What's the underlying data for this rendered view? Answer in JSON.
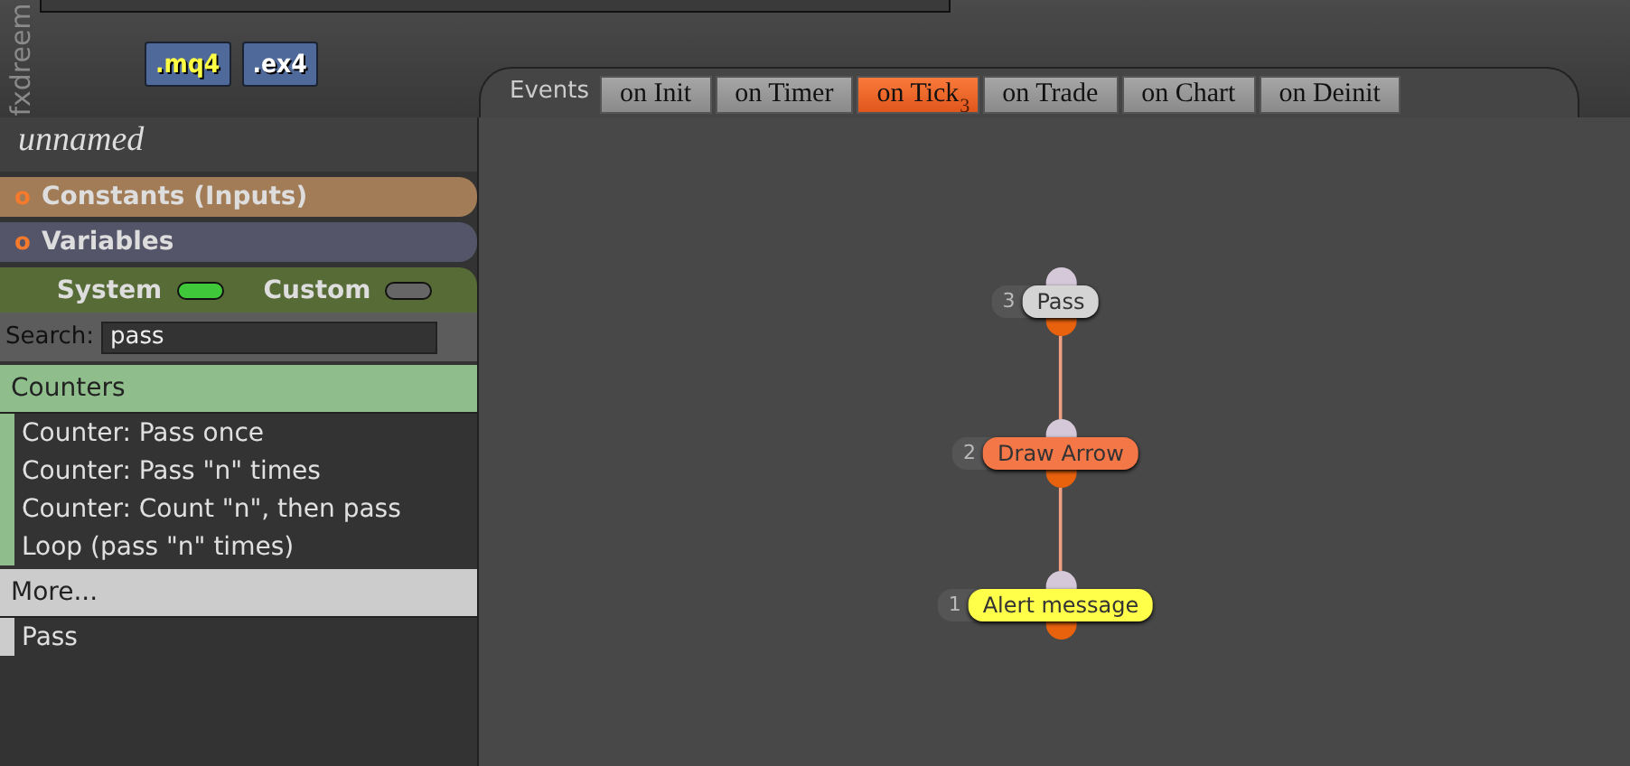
{
  "logo": {
    "text": "fxdreem"
  },
  "file_buttons": [
    {
      "label": ".mq4",
      "kind": "mq4"
    },
    {
      "label": ".ex4",
      "kind": "ex4"
    }
  ],
  "project_name": "unnamed",
  "sections": [
    {
      "marker": "o",
      "label": "Constants (Inputs)",
      "color": "#a17c57"
    },
    {
      "marker": "o",
      "label": "Variables",
      "color": "#55556a"
    }
  ],
  "toggles": [
    {
      "label": "System",
      "on": true
    },
    {
      "label": "Custom",
      "on": false
    }
  ],
  "search": {
    "label": "Search:",
    "value": "pass"
  },
  "groups": [
    {
      "title": "Counters",
      "selected": true,
      "items": [
        "Counter: Pass once",
        "Counter: Pass \"n\" times",
        "Counter: Count \"n\", then pass",
        "Loop (pass \"n\" times)"
      ]
    },
    {
      "title": "More...",
      "selected": false,
      "items": [
        "Pass"
      ]
    }
  ],
  "events": {
    "label": "Events",
    "tabs": [
      {
        "label": "on Init",
        "selected": false
      },
      {
        "label": "on Timer",
        "selected": false
      },
      {
        "label": "on Tick",
        "selected": true,
        "count": "3"
      },
      {
        "label": "on Trade",
        "selected": false
      },
      {
        "label": "on Chart",
        "selected": false
      },
      {
        "label": "on Deinit",
        "selected": false
      }
    ]
  },
  "nodes": [
    {
      "number": "3",
      "label": "Pass",
      "color": "#d4d4d4"
    },
    {
      "number": "2",
      "label": "Draw Arrow",
      "color": "#f47748"
    },
    {
      "number": "1",
      "label": "Alert message",
      "color": "#ffff4a"
    }
  ]
}
